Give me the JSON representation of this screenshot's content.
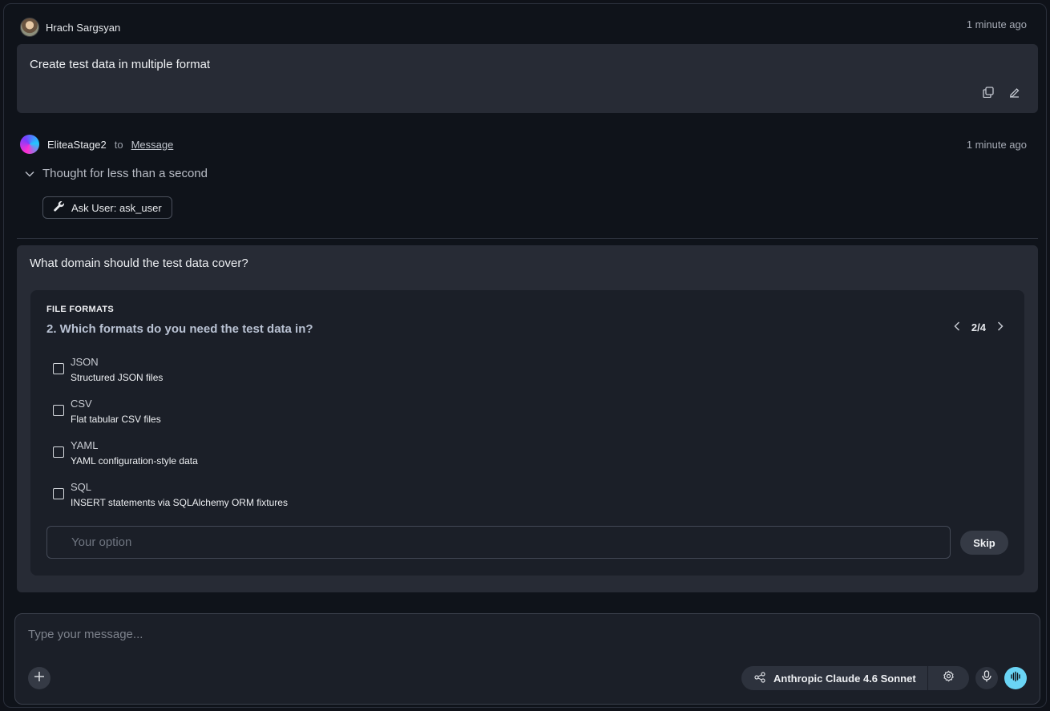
{
  "user_message": {
    "author": "Hrach Sargsyan",
    "time": "1 minute ago",
    "text": "Create test data in multiple format"
  },
  "assistant_message": {
    "author": "EliteaStage2",
    "to_word": "to",
    "target": "Message",
    "time": "1 minute ago",
    "thought": "Thought for less than a second",
    "tool_chip": "Ask User: ask_user"
  },
  "question": {
    "title": "What domain should the test data cover?",
    "section": "FILE FORMATS",
    "sub_question": "2. Which formats do you need the test data in?",
    "pager": "2/4",
    "options": [
      {
        "label": "JSON",
        "desc": "Structured JSON files",
        "checked": false
      },
      {
        "label": "CSV",
        "desc": "Flat tabular CSV files",
        "checked": false
      },
      {
        "label": "YAML",
        "desc": "YAML configuration-style data",
        "checked": false
      },
      {
        "label": "SQL",
        "desc": "INSERT statements via SQLAlchemy ORM fixtures",
        "checked": false
      }
    ],
    "option_placeholder": "Your option",
    "skip_label": "Skip"
  },
  "composer": {
    "placeholder": "Type your message...",
    "model": "Anthropic Claude 4.6 Sonnet"
  },
  "colors": {
    "accent": "#6ad4f5",
    "card": "#272b35",
    "background": "#0f131a"
  }
}
